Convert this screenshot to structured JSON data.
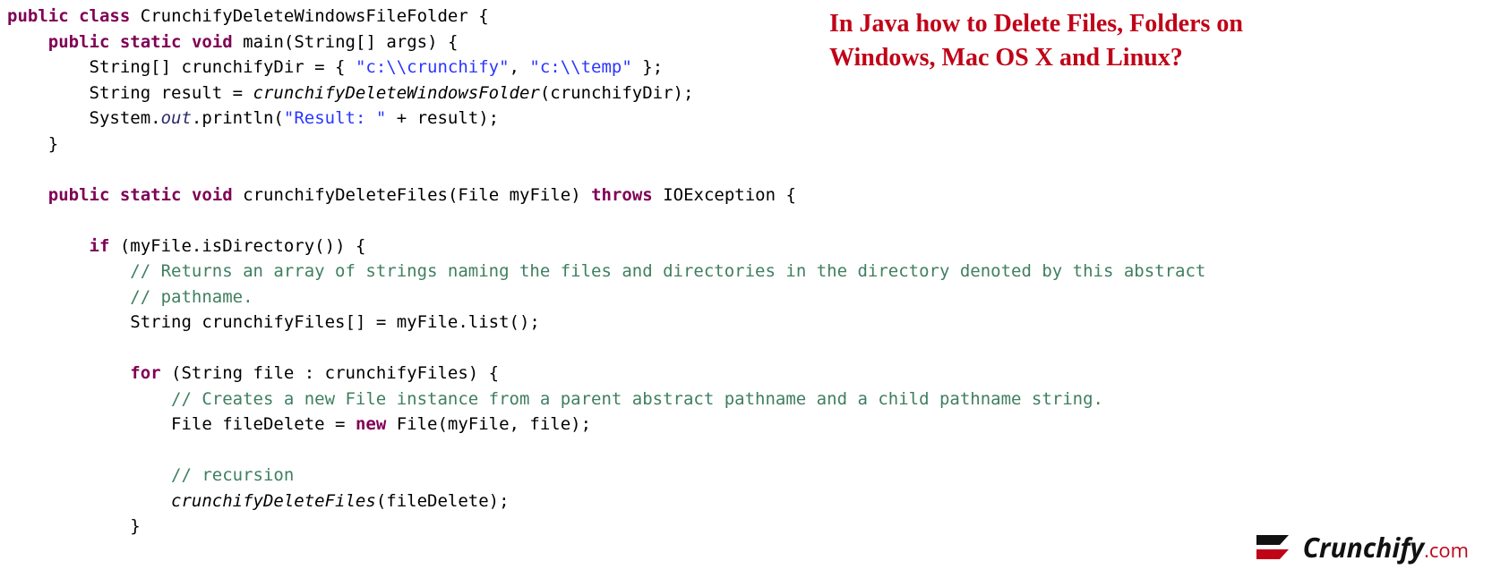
{
  "title_line1": "In Java how to Delete Files, Folders on",
  "title_line2": "Windows, Mac OS X and Linux?",
  "logo_name": "Crunchify",
  "logo_tld": ".com",
  "code": {
    "kw_public1": "public",
    "kw_class": "class",
    "class_name": "CrunchifyDeleteWindowsFileFolder",
    "brace_open": " {",
    "main_sig_pub": "public",
    "main_sig_static": "static",
    "main_sig_void": "void",
    "main_name": "main(String[] args) {",
    "arr_decl": "String[] crunchifyDir = { ",
    "str1": "\"c:\\\\crunchify\"",
    "comma": ", ",
    "str2": "\"c:\\\\temp\"",
    "arr_end": " };",
    "res_decl": "String result = ",
    "call1": "crunchifyDeleteWindowsFolder",
    "call1_args": "(crunchifyDir);",
    "sysout_a": "System.",
    "sysout_out": "out",
    "sysout_b": ".println(",
    "str_result": "\"Result: \"",
    "sysout_c": " + result);",
    "brace_close": "}",
    "m2_pub": "public",
    "m2_static": "static",
    "m2_void": "void",
    "m2_name": "crunchifyDeleteFiles(File myFile) ",
    "m2_throws": "throws",
    "m2_exc": " IOException {",
    "if_kw": "if",
    "if_cond": " (myFile.isDirectory()) {",
    "cm1": "// Returns an array of strings naming the files and directories in the directory denoted by this abstract",
    "cm2": "// pathname.",
    "list_decl": "String crunchifyFiles[] = myFile.list();",
    "for_kw": "for",
    "for_cond": " (String file : crunchifyFiles) {",
    "cm3": "// Creates a new File instance from a parent abstract pathname and a child pathname string.",
    "file_decl_a": "File fileDelete = ",
    "new_kw": "new",
    "file_decl_b": " File(myFile, file);",
    "cm4": "// recursion",
    "rec_call": "crunchifyDeleteFiles",
    "rec_args": "(fileDelete);",
    "brace_close2": "}"
  }
}
